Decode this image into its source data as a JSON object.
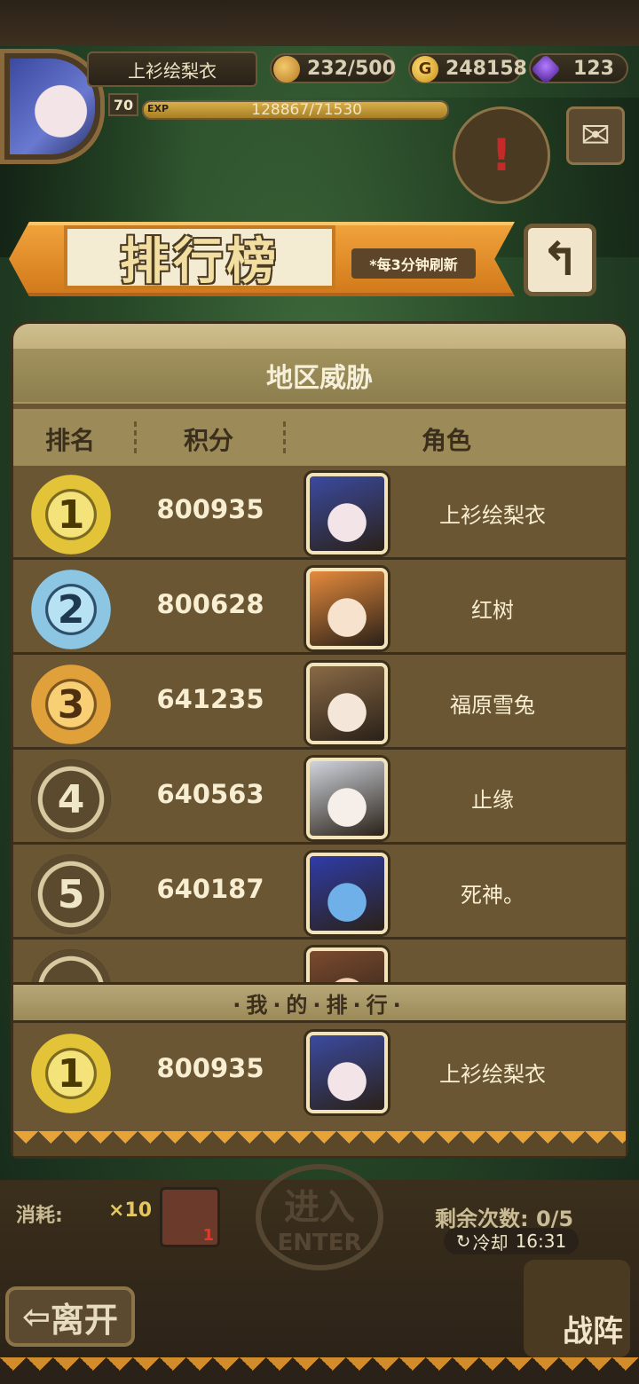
{
  "player": {
    "name": "上衫绘梨衣",
    "level": "70",
    "exp_label": "EXP",
    "exp_value": "128867/71530",
    "exp_fraction": 0.999,
    "stamina": "232/500",
    "gold": "248158",
    "gems": "123"
  },
  "leaderboard": {
    "title": "排行榜",
    "refresh_note": "*每3分钟刷新",
    "back_icon": "return-arrow-icon",
    "region": "地区威胁",
    "columns": {
      "rank": "排名",
      "score": "积分",
      "role": "角色"
    },
    "rows": [
      {
        "rank": "1",
        "score": "800935",
        "name": "上衫绘梨衣",
        "portrait_colors": [
          "#3b4aa0",
          "#f3e4e8"
        ]
      },
      {
        "rank": "2",
        "score": "800628",
        "name": "红树",
        "portrait_colors": [
          "#e58a3c",
          "#f7e2cd"
        ]
      },
      {
        "rank": "3",
        "score": "641235",
        "name": "福原雪兔",
        "portrait_colors": [
          "#8a6a46",
          "#f4e6d8"
        ]
      },
      {
        "rank": "4",
        "score": "640563",
        "name": "止缘",
        "portrait_colors": [
          "#cfd4dc",
          "#f6eee8"
        ]
      },
      {
        "rank": "5",
        "score": "640187",
        "name": "死神。",
        "portrait_colors": [
          "#2f3ca8",
          "#6fb0e8"
        ]
      },
      {
        "rank": "",
        "score": "",
        "name": "",
        "portrait_colors": [
          "#7b4a2e",
          "#f0d0b0"
        ]
      }
    ],
    "my_rank_title": "·我·的·排·行·",
    "my_rank": {
      "rank": "1",
      "score": "800935",
      "name": "上衫绘梨衣",
      "portrait_colors": [
        "#3b4aa0",
        "#f3e4e8"
      ]
    }
  },
  "bottom": {
    "cost_label": "消耗:",
    "cost_amount": "×10",
    "ticket_count": "1",
    "enter_label": "进入",
    "enter_sub": "ENTER",
    "remain": "剩余次数: 0/5",
    "cooldown_label": "冷却",
    "cooldown_time": "16:31",
    "leave_label": "离开",
    "formation_label": "战阵"
  }
}
